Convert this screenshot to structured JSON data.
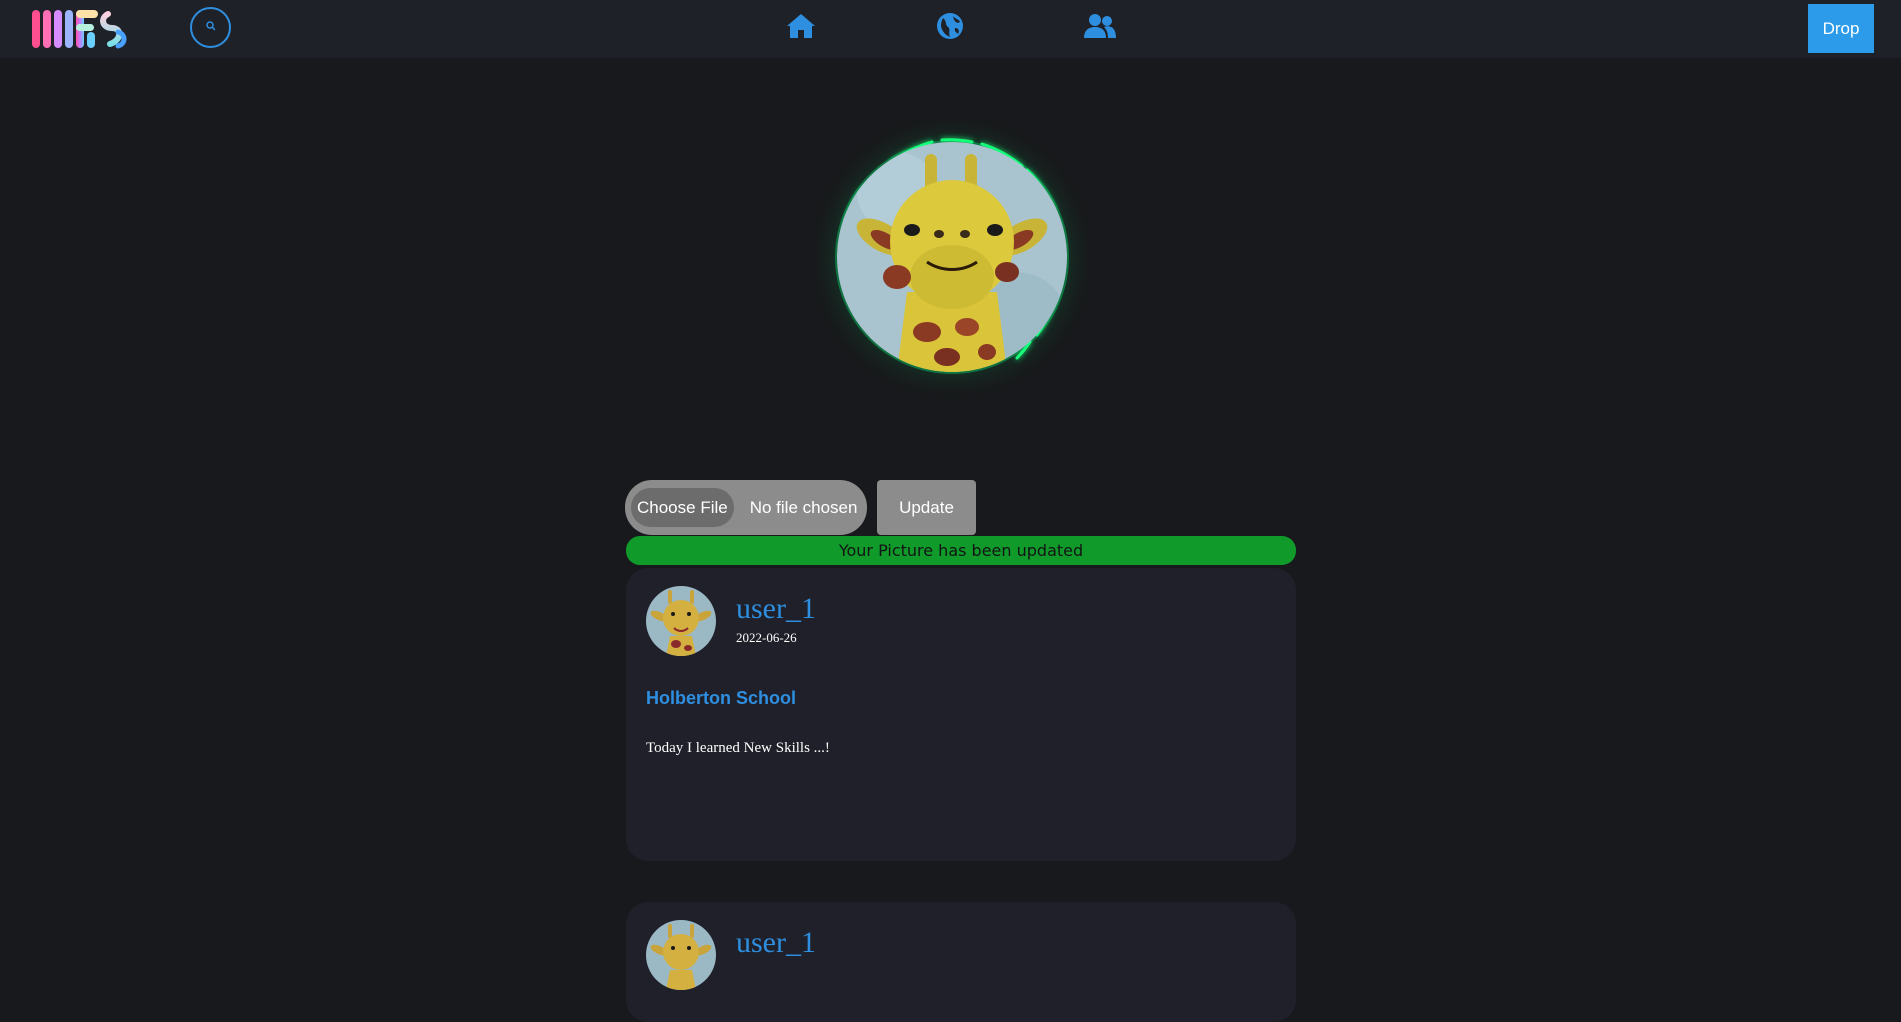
{
  "navbar": {
    "logo_icon": "site-logo",
    "search_icon": "search-icon",
    "nav_items": [
      {
        "icon": "home-icon"
      },
      {
        "icon": "globe-icon"
      },
      {
        "icon": "users-icon"
      }
    ],
    "drop_label": "Drop"
  },
  "profile": {
    "picture_icon": "giraffe-avatar",
    "file_input": {
      "button_label": "Choose File",
      "status": "No file chosen"
    },
    "update_label": "Update",
    "success_message": "Your Picture has been updated"
  },
  "posts": [
    {
      "username": "user_1",
      "date": "2022-06-26",
      "title": "Holberton School",
      "body": "Today I learned New Skills ...!"
    },
    {
      "username": "user_1"
    }
  ],
  "colors": {
    "background": "#18191c",
    "navbar": "#1f2128",
    "accent": "#2e8fe0",
    "success": "#0f9a2a",
    "card": "#1f2029",
    "glow": "#00ff78"
  }
}
